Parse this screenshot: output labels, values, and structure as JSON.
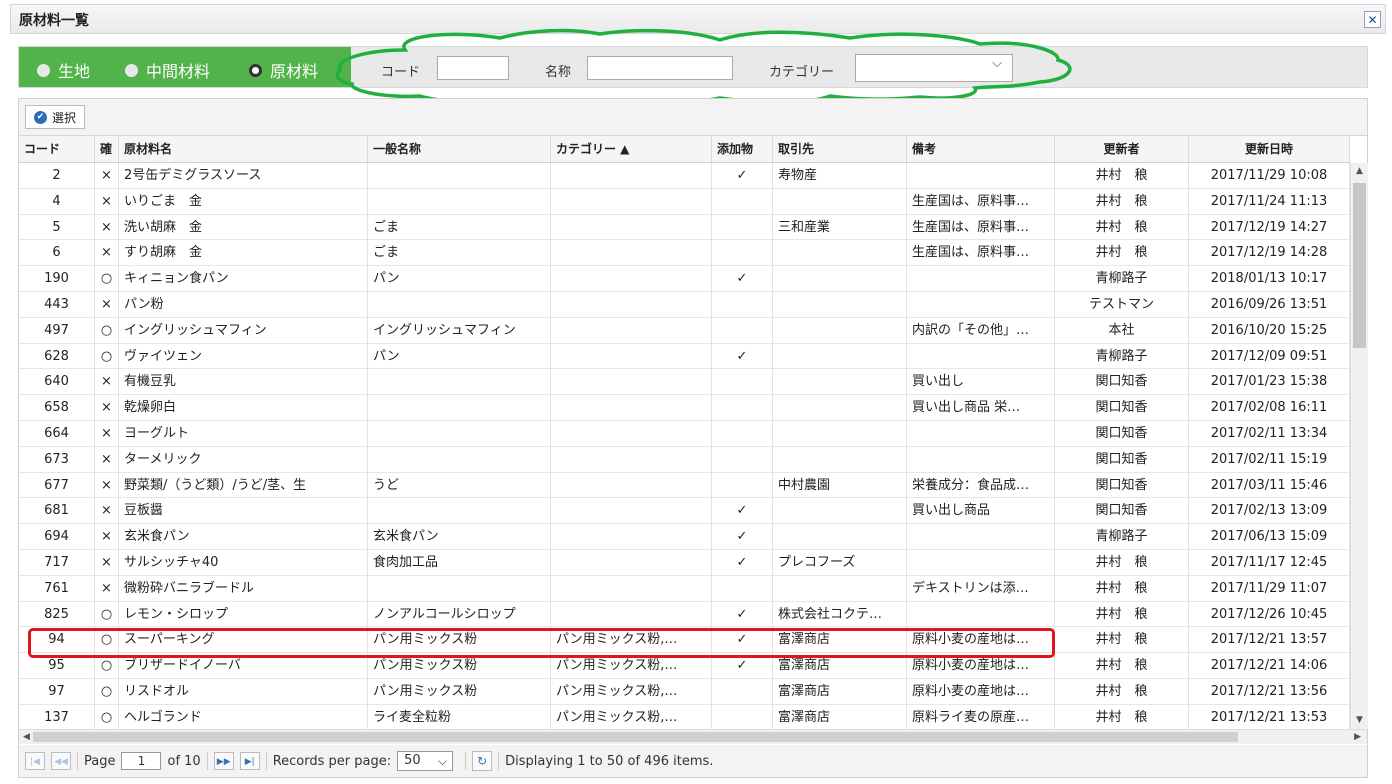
{
  "window": {
    "title": "原材料一覧",
    "close_label": "✕"
  },
  "filter": {
    "radios": [
      {
        "label": "生地",
        "selected": false
      },
      {
        "label": "中間材料",
        "selected": false
      },
      {
        "label": "原材料",
        "selected": true
      }
    ],
    "code_label": "コード",
    "code_value": "",
    "name_label": "名称",
    "name_value": "",
    "category_label": "カテゴリー",
    "category_value": ""
  },
  "toolbar": {
    "select_label": "選択"
  },
  "table": {
    "columns": [
      "コード",
      "確",
      "原材料名",
      "一般名称",
      "カテゴリー ▲",
      "添加物",
      "取引先",
      "備考",
      "更新者",
      "更新日時"
    ],
    "rows": [
      [
        "2",
        "×",
        "2号缶デミグラスソース",
        "",
        "",
        "✓",
        "寿物産",
        "",
        "井村　稂",
        "2017/11/29 10:08"
      ],
      [
        "4",
        "×",
        "いりごま　金",
        "",
        "",
        "",
        "",
        "生産国は、原料事…",
        "井村　稂",
        "2017/11/24 11:13"
      ],
      [
        "5",
        "×",
        "洗い胡麻　金",
        "ごま",
        "",
        "",
        "三和産業",
        "生産国は、原料事…",
        "井村　稂",
        "2017/12/19 14:27"
      ],
      [
        "6",
        "×",
        "すり胡麻　金",
        "ごま",
        "",
        "",
        "",
        "生産国は、原料事…",
        "井村　稂",
        "2017/12/19 14:28"
      ],
      [
        "190",
        "○",
        "キィニョン食パン",
        "パン",
        "",
        "✓",
        "",
        "",
        "青柳路子",
        "2018/01/13 10:17"
      ],
      [
        "443",
        "×",
        "パン粉",
        "",
        "",
        "",
        "",
        "",
        "テストマン",
        "2016/09/26 13:51"
      ],
      [
        "497",
        "○",
        "イングリッシュマフィン",
        "イングリッシュマフィン",
        "",
        "",
        "",
        "内訳の「その他」…",
        "本社",
        "2016/10/20 15:25"
      ],
      [
        "628",
        "○",
        "ヴァイツェン",
        "パン",
        "",
        "✓",
        "",
        "",
        "青柳路子",
        "2017/12/09 09:51"
      ],
      [
        "640",
        "×",
        "有機豆乳",
        "",
        "",
        "",
        "",
        "買い出し",
        "関口知香",
        "2017/01/23 15:38"
      ],
      [
        "658",
        "×",
        "乾燥卵白",
        "",
        "",
        "",
        "",
        "買い出し商品 栄…",
        "関口知香",
        "2017/02/08 16:11"
      ],
      [
        "664",
        "×",
        "ヨーグルト",
        "",
        "",
        "",
        "",
        "",
        "関口知香",
        "2017/02/11 13:34"
      ],
      [
        "673",
        "×",
        "ターメリック",
        "",
        "",
        "",
        "",
        "",
        "関口知香",
        "2017/02/11 15:19"
      ],
      [
        "677",
        "×",
        "野菜類/（うど類）/うど/茎、生",
        "うど",
        "",
        "",
        "中村農園",
        "栄養成分：食品成…",
        "関口知香",
        "2017/03/11 15:46"
      ],
      [
        "681",
        "×",
        "豆板醤",
        "",
        "",
        "✓",
        "",
        "買い出し商品",
        "関口知香",
        "2017/02/13 13:09"
      ],
      [
        "694",
        "×",
        "玄米食パン",
        "玄米食パン",
        "",
        "✓",
        "",
        "",
        "青柳路子",
        "2017/06/13 15:09"
      ],
      [
        "717",
        "×",
        "サルシッチャ40",
        "食肉加工品",
        "",
        "✓",
        "プレコフーズ",
        "",
        "井村　稂",
        "2017/11/17 12:45"
      ],
      [
        "761",
        "×",
        "微粉砕バニラブードル",
        "",
        "",
        "",
        "",
        "デキストリンは添…",
        "井村　稂",
        "2017/11/29 11:07"
      ],
      [
        "825",
        "○",
        "レモン・シロップ",
        "ノンアルコールシロップ",
        "",
        "✓",
        "株式会社コクテ…",
        "",
        "井村　稂",
        "2017/12/26 10:45"
      ],
      [
        "94",
        "○",
        "スーパーキング",
        "パン用ミックス粉",
        "パン用ミックス粉,…",
        "✓",
        "富澤商店",
        "原料小麦の産地は…",
        "井村　稂",
        "2017/12/21 13:57"
      ],
      [
        "95",
        "○",
        "ブリザードイノーバ",
        "パン用ミックス粉",
        "パン用ミックス粉,…",
        "✓",
        "富澤商店",
        "原料小麦の産地は…",
        "井村　稂",
        "2017/12/21 14:06"
      ],
      [
        "97",
        "○",
        "リスドオル",
        "パン用ミックス粉",
        "パン用ミックス粉,…",
        "",
        "富澤商店",
        "原料小麦の産地は…",
        "井村　稂",
        "2017/12/21 13:56"
      ],
      [
        "137",
        "○",
        "ヘルゴランド",
        "ライ麦全粒粉",
        "パン用ミックス粉,…",
        "",
        "富澤商店",
        "原料ライ麦の原産…",
        "井村　稂",
        "2017/12/21 13:53"
      ]
    ]
  },
  "pager": {
    "page_label": "Page",
    "page_value": "1",
    "of_label": "of 10",
    "records_label": "Records per page:",
    "records_value": "50",
    "display_text": "Displaying 1 to 50 of 496 items."
  },
  "colors": {
    "accent_green": "#52b34a",
    "annotation_green": "#20b040",
    "highlight_red": "#e0161c"
  }
}
